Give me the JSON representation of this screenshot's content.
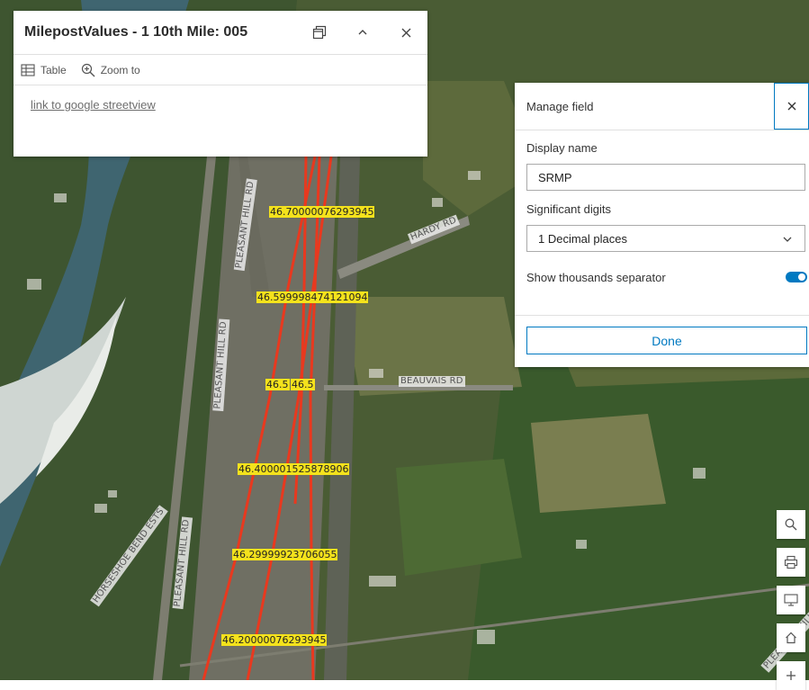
{
  "popup": {
    "title": "MilepostValues - 1 10th Mile: 005",
    "actions": {
      "table": "Table",
      "zoom_to": "Zoom to"
    },
    "link_text": "link to google streetview"
  },
  "manage_field": {
    "title": "Manage field",
    "display_name_label": "Display name",
    "display_name_value": "SRMP",
    "significant_digits_label": "Significant digits",
    "significant_digits_value": "1 Decimal places",
    "thousands_separator_label": "Show thousands separator",
    "thousands_separator_on": true,
    "done_label": "Done"
  },
  "map": {
    "milepost_labels": [
      "46.70000076293945",
      "46.599998474121094",
      "46.5",
      "46.5",
      "46.400001525878906",
      "46.29999923706055",
      "46.20000076293945"
    ],
    "road_labels": [
      "PLEASANT HILL RD",
      "HARDY RD",
      "PLEASANT HILL RD",
      "BEAUVAIS RD",
      "HORSESHOE BEND ESTS",
      "PLEASANT HILL RD",
      "PLEASANT HILL RD"
    ],
    "tools": [
      "search-icon",
      "print-icon",
      "screen-icon",
      "home-icon",
      "zoom-in-icon"
    ]
  }
}
